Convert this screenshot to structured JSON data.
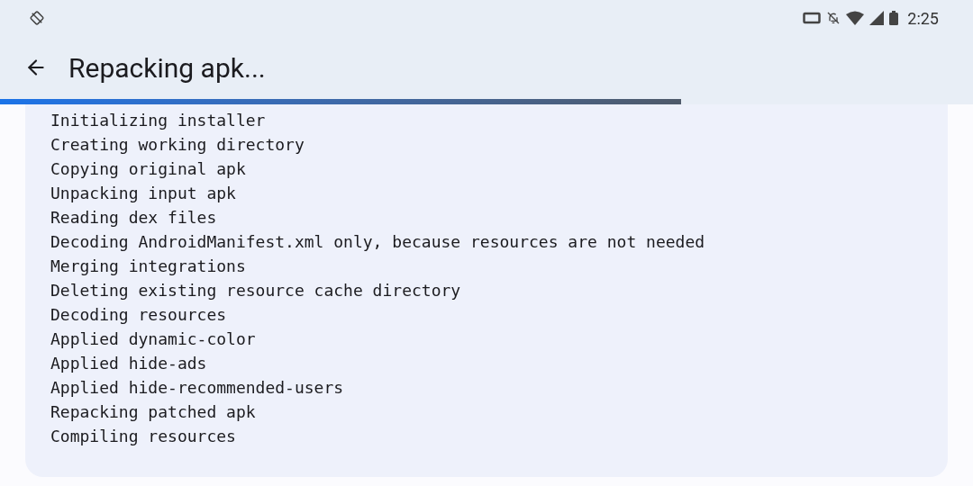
{
  "status_bar": {
    "time": "2:25"
  },
  "app_bar": {
    "title": "Repacking apk..."
  },
  "progress": {
    "level": 0.7
  },
  "log": [
    "Initializing installer",
    "Creating working directory",
    "Copying original apk",
    "Unpacking input apk",
    "Reading dex files",
    "Decoding AndroidManifest.xml only, because resources are not needed",
    "Merging integrations",
    "Deleting existing resource cache directory",
    "Decoding resources",
    "Applied dynamic-color",
    "Applied hide-ads",
    "Applied hide-recommended-users",
    "Repacking patched apk",
    "Compiling resources"
  ]
}
